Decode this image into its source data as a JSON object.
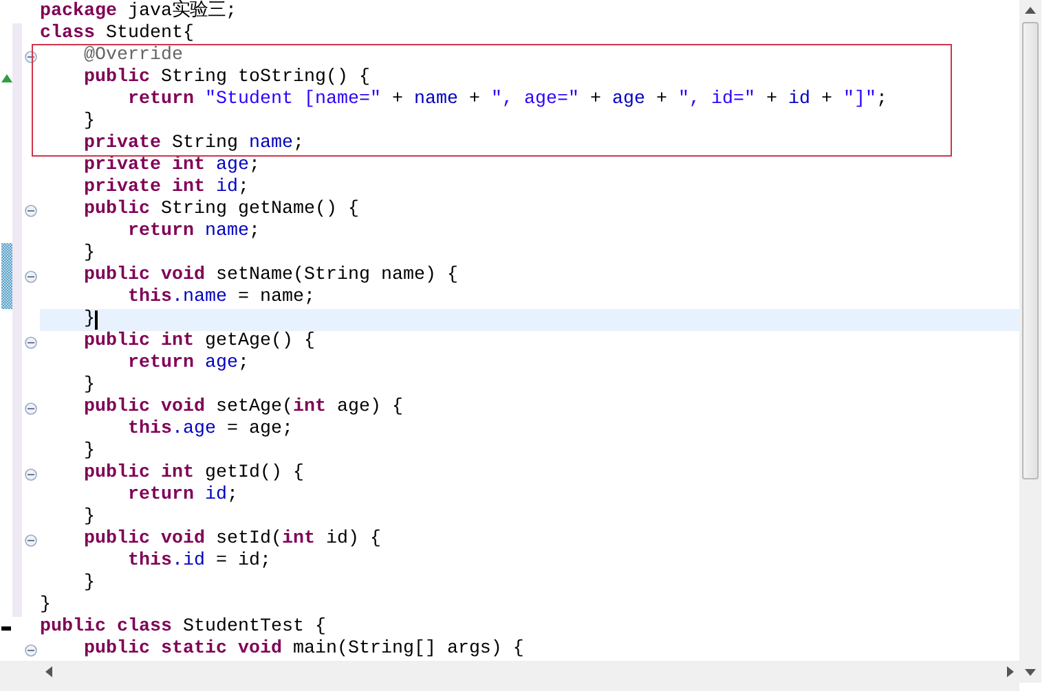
{
  "lines": [
    {
      "tokens": [
        {
          "kind": "keyword",
          "text": "package"
        },
        {
          "kind": "plain",
          "text": " java实验三;"
        }
      ]
    },
    {
      "tokens": [
        {
          "kind": "keyword",
          "text": "class"
        },
        {
          "kind": "plain",
          "text": " Student{"
        }
      ]
    },
    {
      "fold": true,
      "boxed": true,
      "tokens": [
        {
          "kind": "annotation",
          "text": "    @Override"
        }
      ]
    },
    {
      "override": true,
      "boxed": true,
      "tokens": [
        {
          "kind": "keyword",
          "text": "    public"
        },
        {
          "kind": "plain",
          "text": " String toString() {"
        }
      ]
    },
    {
      "boxed": true,
      "tokens": [
        {
          "kind": "keyword",
          "text": "        return "
        },
        {
          "kind": "string",
          "text": "\"Student [name=\""
        },
        {
          "kind": "plain",
          "text": " + "
        },
        {
          "kind": "field",
          "text": "name"
        },
        {
          "kind": "plain",
          "text": " + "
        },
        {
          "kind": "string",
          "text": "\", age=\""
        },
        {
          "kind": "plain",
          "text": " + "
        },
        {
          "kind": "field",
          "text": "age"
        },
        {
          "kind": "plain",
          "text": " + "
        },
        {
          "kind": "string",
          "text": "\", id=\""
        },
        {
          "kind": "plain",
          "text": " + "
        },
        {
          "kind": "field",
          "text": "id"
        },
        {
          "kind": "plain",
          "text": " + "
        },
        {
          "kind": "string",
          "text": "\"]\""
        },
        {
          "kind": "plain",
          "text": ";"
        }
      ]
    },
    {
      "boxed": true,
      "tokens": [
        {
          "kind": "plain",
          "text": "    }"
        }
      ]
    },
    {
      "boxed": true,
      "tokens": [
        {
          "kind": "keyword",
          "text": "    private"
        },
        {
          "kind": "plain",
          "text": " String "
        },
        {
          "kind": "field",
          "text": "name"
        },
        {
          "kind": "plain",
          "text": ";"
        }
      ]
    },
    {
      "tokens": [
        {
          "kind": "keyword",
          "text": "    private int "
        },
        {
          "kind": "field",
          "text": "age"
        },
        {
          "kind": "plain",
          "text": ";"
        }
      ]
    },
    {
      "tokens": [
        {
          "kind": "keyword",
          "text": "    private int "
        },
        {
          "kind": "field",
          "text": "id"
        },
        {
          "kind": "plain",
          "text": ";"
        }
      ]
    },
    {
      "fold": true,
      "tokens": [
        {
          "kind": "keyword",
          "text": "    public"
        },
        {
          "kind": "plain",
          "text": " String getName() {"
        }
      ]
    },
    {
      "tokens": [
        {
          "kind": "keyword",
          "text": "        return "
        },
        {
          "kind": "field",
          "text": "name"
        },
        {
          "kind": "plain",
          "text": ";"
        }
      ]
    },
    {
      "changed": true,
      "tokens": [
        {
          "kind": "plain",
          "text": "    }"
        }
      ]
    },
    {
      "fold": true,
      "changed": true,
      "tokens": [
        {
          "kind": "keyword",
          "text": "    public void"
        },
        {
          "kind": "plain",
          "text": " setName(String name) {"
        }
      ]
    },
    {
      "changed": true,
      "tokens": [
        {
          "kind": "keyword",
          "text": "        this"
        },
        {
          "kind": "field",
          "text": ".name"
        },
        {
          "kind": "plain",
          "text": " = name;"
        }
      ]
    },
    {
      "current": true,
      "caret": true,
      "tokens": [
        {
          "kind": "plain",
          "text": "    }"
        }
      ]
    },
    {
      "fold": true,
      "tokens": [
        {
          "kind": "keyword",
          "text": "    public int"
        },
        {
          "kind": "plain",
          "text": " getAge() {"
        }
      ]
    },
    {
      "tokens": [
        {
          "kind": "keyword",
          "text": "        return "
        },
        {
          "kind": "field",
          "text": "age"
        },
        {
          "kind": "plain",
          "text": ";"
        }
      ]
    },
    {
      "tokens": [
        {
          "kind": "plain",
          "text": "    }"
        }
      ]
    },
    {
      "fold": true,
      "tokens": [
        {
          "kind": "keyword",
          "text": "    public void"
        },
        {
          "kind": "plain",
          "text": " setAge("
        },
        {
          "kind": "keyword",
          "text": "int"
        },
        {
          "kind": "plain",
          "text": " age) {"
        }
      ]
    },
    {
      "tokens": [
        {
          "kind": "keyword",
          "text": "        this"
        },
        {
          "kind": "field",
          "text": ".age"
        },
        {
          "kind": "plain",
          "text": " = age;"
        }
      ]
    },
    {
      "tokens": [
        {
          "kind": "plain",
          "text": "    }"
        }
      ]
    },
    {
      "fold": true,
      "tokens": [
        {
          "kind": "keyword",
          "text": "    public int"
        },
        {
          "kind": "plain",
          "text": " getId() {"
        }
      ]
    },
    {
      "tokens": [
        {
          "kind": "keyword",
          "text": "        return "
        },
        {
          "kind": "field",
          "text": "id"
        },
        {
          "kind": "plain",
          "text": ";"
        }
      ]
    },
    {
      "tokens": [
        {
          "kind": "plain",
          "text": "    }"
        }
      ]
    },
    {
      "fold": true,
      "tokens": [
        {
          "kind": "keyword",
          "text": "    public void"
        },
        {
          "kind": "plain",
          "text": " setId("
        },
        {
          "kind": "keyword",
          "text": "int"
        },
        {
          "kind": "plain",
          "text": " id) {"
        }
      ]
    },
    {
      "tokens": [
        {
          "kind": "keyword",
          "text": "        this"
        },
        {
          "kind": "field",
          "text": ".id"
        },
        {
          "kind": "plain",
          "text": " = id;"
        }
      ]
    },
    {
      "tokens": [
        {
          "kind": "plain",
          "text": "    }"
        }
      ]
    },
    {
      "tokens": [
        {
          "kind": "plain",
          "text": "}"
        }
      ]
    },
    {
      "bookmarked": true,
      "tokens": [
        {
          "kind": "keyword",
          "text": "public class"
        },
        {
          "kind": "plain",
          "text": " StudentTest {"
        }
      ]
    },
    {
      "fold": true,
      "tokens": [
        {
          "kind": "keyword",
          "text": "    public static void"
        },
        {
          "kind": "plain",
          "text": " main(String[] args) {"
        }
      ]
    }
  ]
}
